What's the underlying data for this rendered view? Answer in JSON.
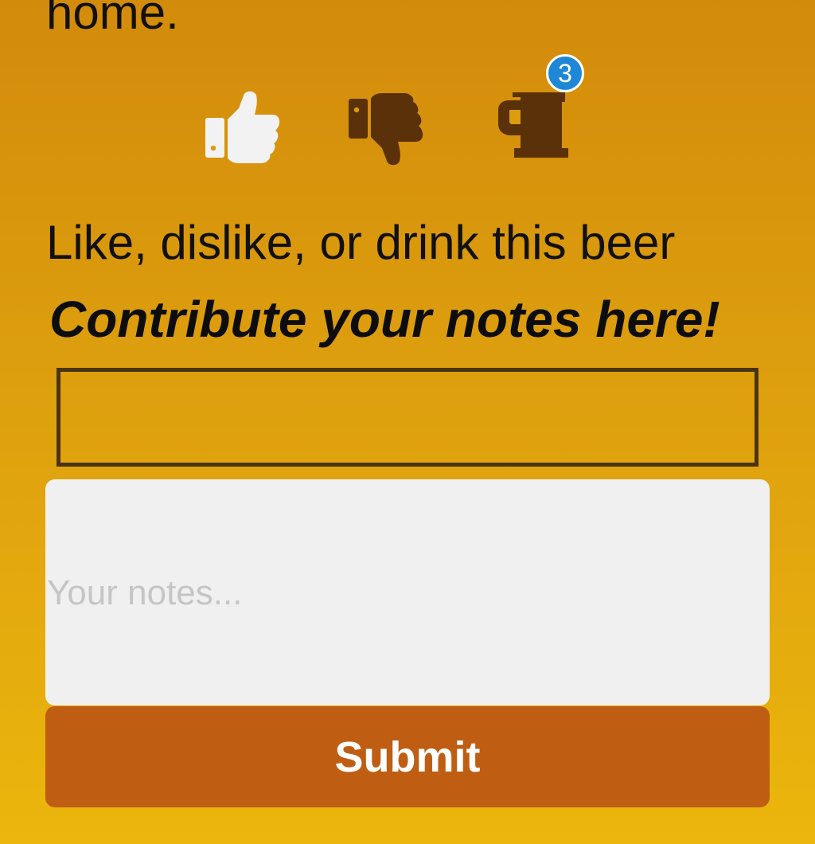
{
  "intro": {
    "tail_text": "home."
  },
  "actions": {
    "like": {
      "icon": "thumbs-up-icon",
      "color": "#f2f2f2",
      "state": "selected"
    },
    "dislike": {
      "icon": "thumbs-down-icon",
      "color": "#5a3108"
    },
    "drink": {
      "icon": "beer-mug-icon",
      "color": "#5a3108",
      "badge_count": "3",
      "badge_color": "#1e88d6"
    }
  },
  "prompt": {
    "text": "Like, dislike, or drink this beer"
  },
  "contribute": {
    "heading": "Contribute your notes here!",
    "title_input_value": "",
    "notes_placeholder": "Your notes...",
    "notes_value": "",
    "submit_label": "Submit"
  },
  "colors": {
    "background_top": "#d38b0b",
    "background_bottom": "#ebb60d",
    "submit_button": "#bf5e12",
    "input_border": "#4a3410",
    "notes_background": "#f0f0f0"
  }
}
